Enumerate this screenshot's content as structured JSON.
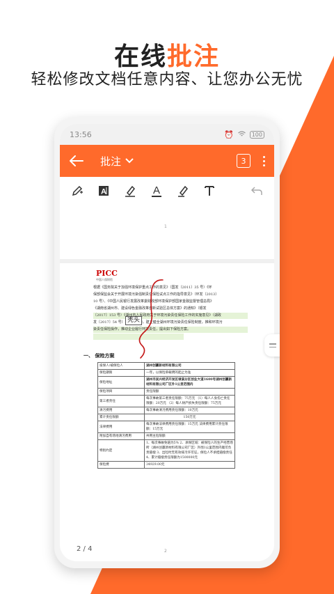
{
  "promo": {
    "headline_plain": "在线",
    "headline_accent": "批注",
    "subline": "轻松修改文档任意内容、让您办公无忧"
  },
  "colors": {
    "accent": "#ff6a2b",
    "toolbar_icon": "#333333"
  },
  "statusbar": {
    "time": "13:56",
    "battery": "100"
  },
  "appbar": {
    "title": "批注",
    "annotation_count": "3"
  },
  "toolbar": {
    "tools": [
      {
        "name": "pen-icon"
      },
      {
        "name": "text-box-icon"
      },
      {
        "name": "highlighter-icon"
      },
      {
        "name": "font-color-icon",
        "glyph": "A"
      },
      {
        "name": "marker-icon"
      },
      {
        "name": "text-icon",
        "glyph": "T"
      },
      {
        "name": "undo-icon"
      }
    ]
  },
  "document": {
    "page1_number": "1",
    "page2_number": "2",
    "logo": "PICC",
    "logo_sub": "中国人保财险",
    "paragraph": [
      "根据《国务院关于加强环境保护重点工作的意见》（国发〔2011〕35 号）《环",
      "保部保监会关于开展环境污染强制责任保险试点工作的指导意见》（环发〔2013〕",
      "10 号）、《中国人民银行发展改革委财政部环境保护部国家金融监督管理总局》",
      "《湖南省湖州市、建设绿色金融改革创新试验区总体方案》的通知》（银发",
      "〔2017〕153 号）《湖州市人民政府关于环境污染责任保险工作的实施意见》（湖政",
      "发〔2017〕54 号）等文件精神，建立健全湖州环境污染责任保险制度，推和环境污",
      "染责任保险操作，推动企业履行环境责任，提出如下保险方案。"
    ],
    "annotation_text": "秃头",
    "section_title": "一、 保险方案",
    "table": [
      [
        "投保人/被保险人",
        "湖州创赢新材料有限公司"
      ],
      [
        "保险期限",
        "一年，以保险单载明的起止为准"
      ],
      [
        "保险地址",
        "湖州市吴兴经济开发区埭溪分区创业大道1600号湖州创赢新材料有限公司厂区外1公里范围内"
      ],
      [
        "保险项目",
        "责任限额"
      ],
      [
        "第三者责任",
        "每次事故第三者责任限额：75万元 （1）每人人身伤亡责任限额：20万元 （2）每人财产损失责任限额：75万元"
      ],
      [
        "清污费用",
        "每次事故清污费用责任限额：10万元"
      ],
      [
        "累计责任限额",
        "150万元"
      ],
      [
        "法律费用",
        "每次事故法律费用责任限额：15万元 法律费用累计责任限额：15万元"
      ],
      [
        "附加自有场地清污费用",
        "共用主险限额"
      ],
      [
        "特别约定",
        "1、每次事故免赔为5% 2、承保区域：被保险人的生产经营场所（湖州创赢新材料有限公司厂区）外围1公里范围内栽可负责赔偿 3、出险时无有效排污许可证，保险人不承担赔偿责任 4、累计赔偿责任限额为1500000元"
      ],
      [
        "保险费",
        "34929.00元"
      ]
    ],
    "page_indicator": "2 / 4"
  }
}
